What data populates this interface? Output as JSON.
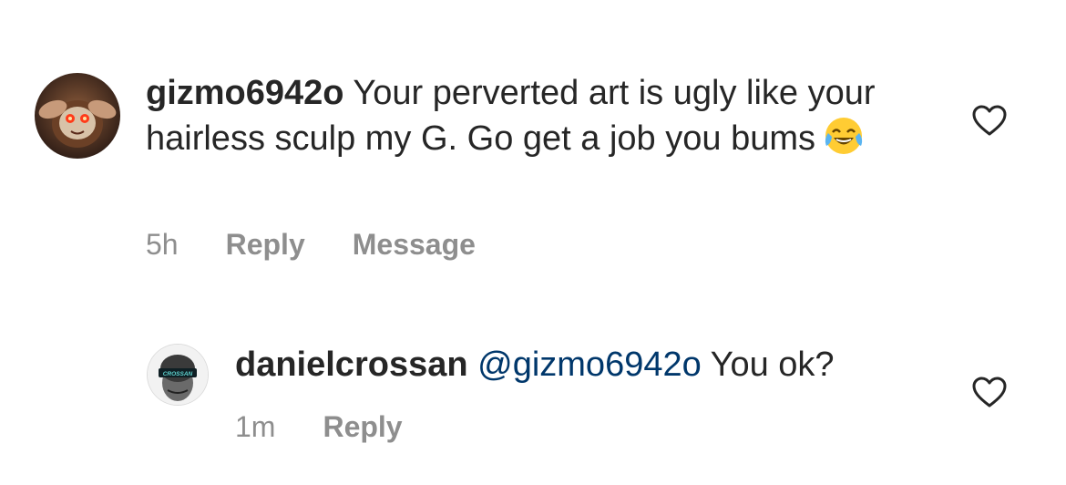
{
  "comments": [
    {
      "username": "gizmo6942o",
      "text": "Your perverted art is ugly like your hairless sculp my G. Go get a job you bums",
      "emoji": "face-with-tears-of-joy-icon",
      "time": "5h",
      "reply_label": "Reply",
      "message_label": "Message"
    },
    {
      "username": "danielcrossan",
      "mention": "@gizmo6942o",
      "text": "You ok?",
      "avatar_badge_text": "CROSSAN",
      "time": "1m",
      "reply_label": "Reply"
    }
  ],
  "colors": {
    "text": "#262626",
    "meta": "#8e8e8e",
    "mention": "#00376b"
  }
}
